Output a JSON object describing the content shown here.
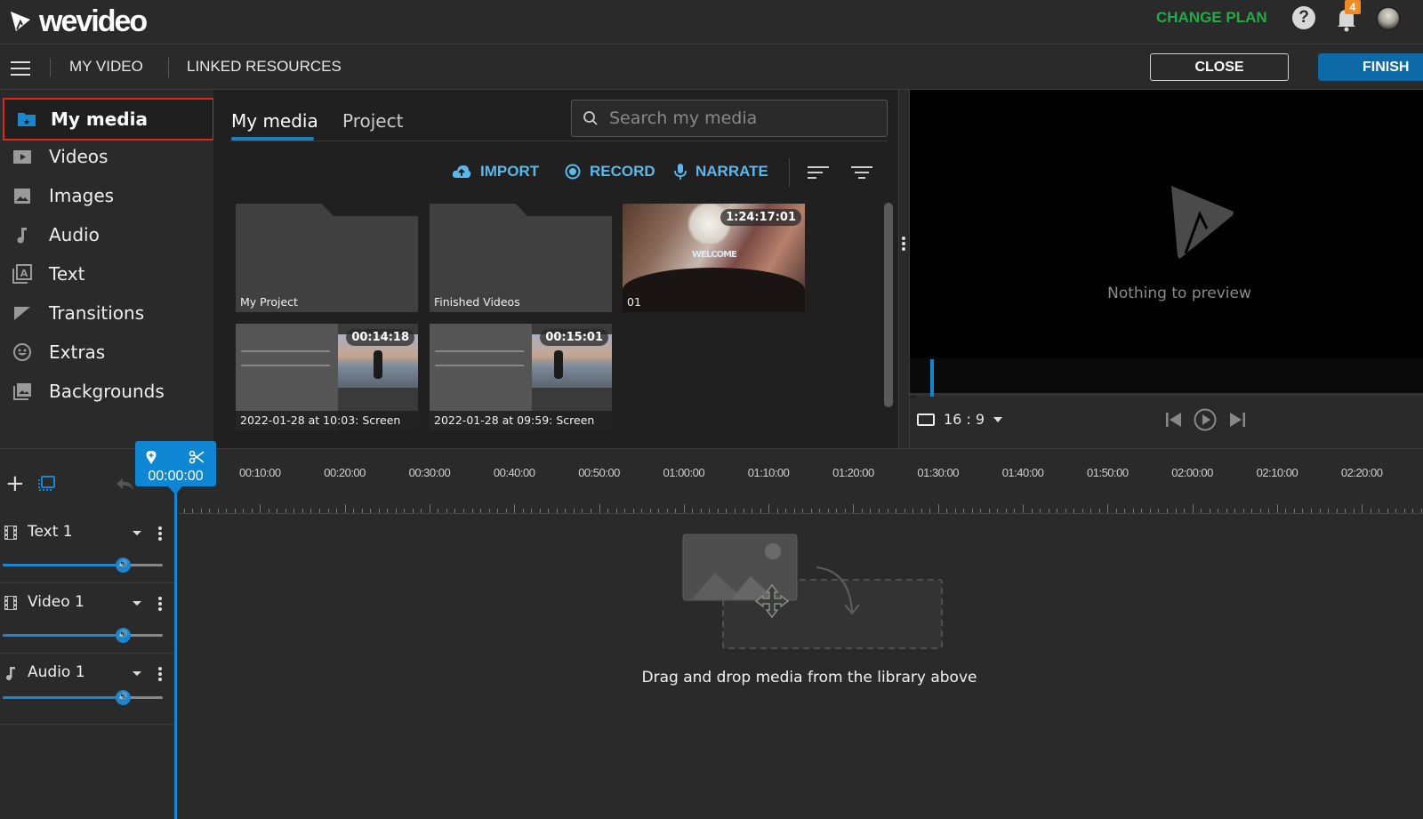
{
  "app": {
    "brand": "wevideo"
  },
  "topbar": {
    "change_plan": "CHANGE PLAN",
    "notification_count": "4",
    "help_symbol": "?"
  },
  "navbar": {
    "links": [
      "MY VIDEO",
      "LINKED RESOURCES"
    ],
    "close_label": "CLOSE",
    "finish_label": "FINISH"
  },
  "sidebar": {
    "items": [
      {
        "label": "My media",
        "icon": "folder-star-icon",
        "active": true
      },
      {
        "label": "Videos",
        "icon": "video-icon"
      },
      {
        "label": "Images",
        "icon": "image-icon"
      },
      {
        "label": "Audio",
        "icon": "music-note-icon"
      },
      {
        "label": "Text",
        "icon": "text-icon"
      },
      {
        "label": "Transitions",
        "icon": "transition-icon"
      },
      {
        "label": "Extras",
        "icon": "smiley-icon"
      },
      {
        "label": "Backgrounds",
        "icon": "backgrounds-icon"
      }
    ]
  },
  "media": {
    "tabs": [
      {
        "label": "My media",
        "active": true
      },
      {
        "label": "Project"
      }
    ],
    "search_placeholder": "Search my media",
    "actions": {
      "import": "IMPORT",
      "record": "RECORD",
      "narrate": "NARRATE"
    },
    "items": [
      {
        "type": "folder",
        "name": "My Project"
      },
      {
        "type": "folder",
        "name": "Finished Videos"
      },
      {
        "type": "video",
        "name": "01",
        "duration": "1:24:17:01"
      },
      {
        "type": "video",
        "name": "2022-01-28 at 10:03: Screen",
        "duration": "00:14:18"
      },
      {
        "type": "video",
        "name": "2022-01-28 at 09:59: Screen",
        "duration": "00:15:01"
      }
    ]
  },
  "preview": {
    "empty_text": "Nothing to preview",
    "aspect_ratio": "16 : 9"
  },
  "timeline": {
    "playhead_time": "00:00:00",
    "ticks": [
      "00:10:00",
      "00:20:00",
      "00:30:00",
      "00:40:00",
      "00:50:00",
      "01:00:00",
      "01:10:00",
      "01:20:00",
      "01:30:00",
      "01:40:00",
      "01:50:00",
      "02:00:00",
      "02:10:00",
      "02:20:00"
    ],
    "tracks": [
      {
        "name": "Text 1",
        "icon": "film-icon",
        "volume_percent": 75
      },
      {
        "name": "Video 1",
        "icon": "film-icon",
        "volume_percent": 75
      },
      {
        "name": "Audio 1",
        "icon": "music-note-icon",
        "volume_percent": 75
      }
    ],
    "drop_hint": "Drag and drop media from the library above"
  },
  "colors": {
    "accent": "#0e86d4",
    "change_plan": "#1fae46",
    "badge": "#f08a24",
    "active_outline": "#e0261b",
    "action": "#5bb8ea"
  }
}
